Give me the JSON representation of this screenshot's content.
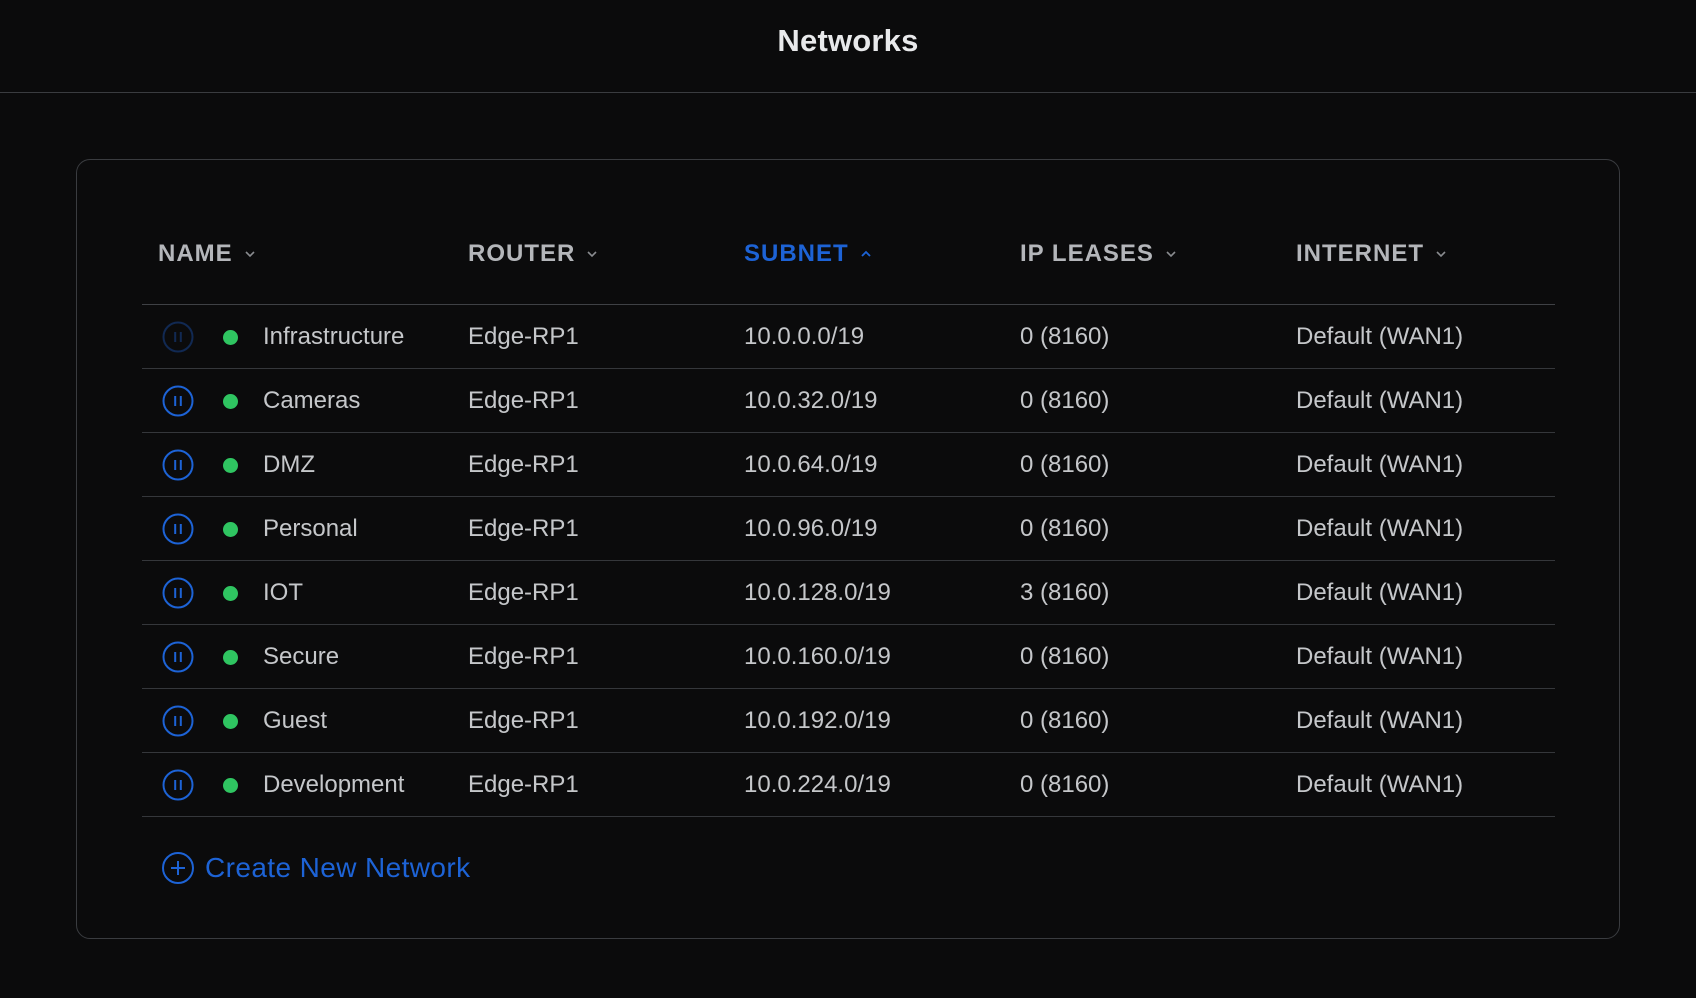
{
  "header": {
    "title": "Networks"
  },
  "table": {
    "columns": [
      {
        "label": "NAME",
        "sort": "desc",
        "active": false
      },
      {
        "label": "ROUTER",
        "sort": "desc",
        "active": false
      },
      {
        "label": "SUBNET",
        "sort": "asc",
        "active": true
      },
      {
        "label": "IP LEASES",
        "sort": "desc",
        "active": false
      },
      {
        "label": "INTERNET",
        "sort": "desc",
        "active": false
      }
    ],
    "rows": [
      {
        "name": "Infrastructure",
        "router": "Edge-RP1",
        "subnet": "10.0.0.0/19",
        "leases": "0 (8160)",
        "internet": "Default (WAN1)",
        "pause_enabled": false,
        "status": "online"
      },
      {
        "name": "Cameras",
        "router": "Edge-RP1",
        "subnet": "10.0.32.0/19",
        "leases": "0 (8160)",
        "internet": "Default (WAN1)",
        "pause_enabled": true,
        "status": "online"
      },
      {
        "name": "DMZ",
        "router": "Edge-RP1",
        "subnet": "10.0.64.0/19",
        "leases": "0 (8160)",
        "internet": "Default (WAN1)",
        "pause_enabled": true,
        "status": "online"
      },
      {
        "name": "Personal",
        "router": "Edge-RP1",
        "subnet": "10.0.96.0/19",
        "leases": "0 (8160)",
        "internet": "Default (WAN1)",
        "pause_enabled": true,
        "status": "online"
      },
      {
        "name": "IOT",
        "router": "Edge-RP1",
        "subnet": "10.0.128.0/19",
        "leases": "3 (8160)",
        "internet": "Default (WAN1)",
        "pause_enabled": true,
        "status": "online"
      },
      {
        "name": "Secure",
        "router": "Edge-RP1",
        "subnet": "10.0.160.0/19",
        "leases": "0 (8160)",
        "internet": "Default (WAN1)",
        "pause_enabled": true,
        "status": "online"
      },
      {
        "name": "Guest",
        "router": "Edge-RP1",
        "subnet": "10.0.192.0/19",
        "leases": "0 (8160)",
        "internet": "Default (WAN1)",
        "pause_enabled": true,
        "status": "online"
      },
      {
        "name": "Development",
        "router": "Edge-RP1",
        "subnet": "10.0.224.0/19",
        "leases": "0 (8160)",
        "internet": "Default (WAN1)",
        "pause_enabled": true,
        "status": "online"
      }
    ]
  },
  "actions": {
    "create_label": "Create New Network"
  },
  "icons": {
    "pause": "pause-circle-icon",
    "status": "status-dot",
    "sort": "chevron-icon",
    "create": "plus-circle-icon"
  },
  "colors": {
    "background": "#0b0b0c",
    "accent": "#1d63d6",
    "status_online": "#2fc561",
    "divider": "#3a3c40",
    "text": "#c5c7ca"
  }
}
